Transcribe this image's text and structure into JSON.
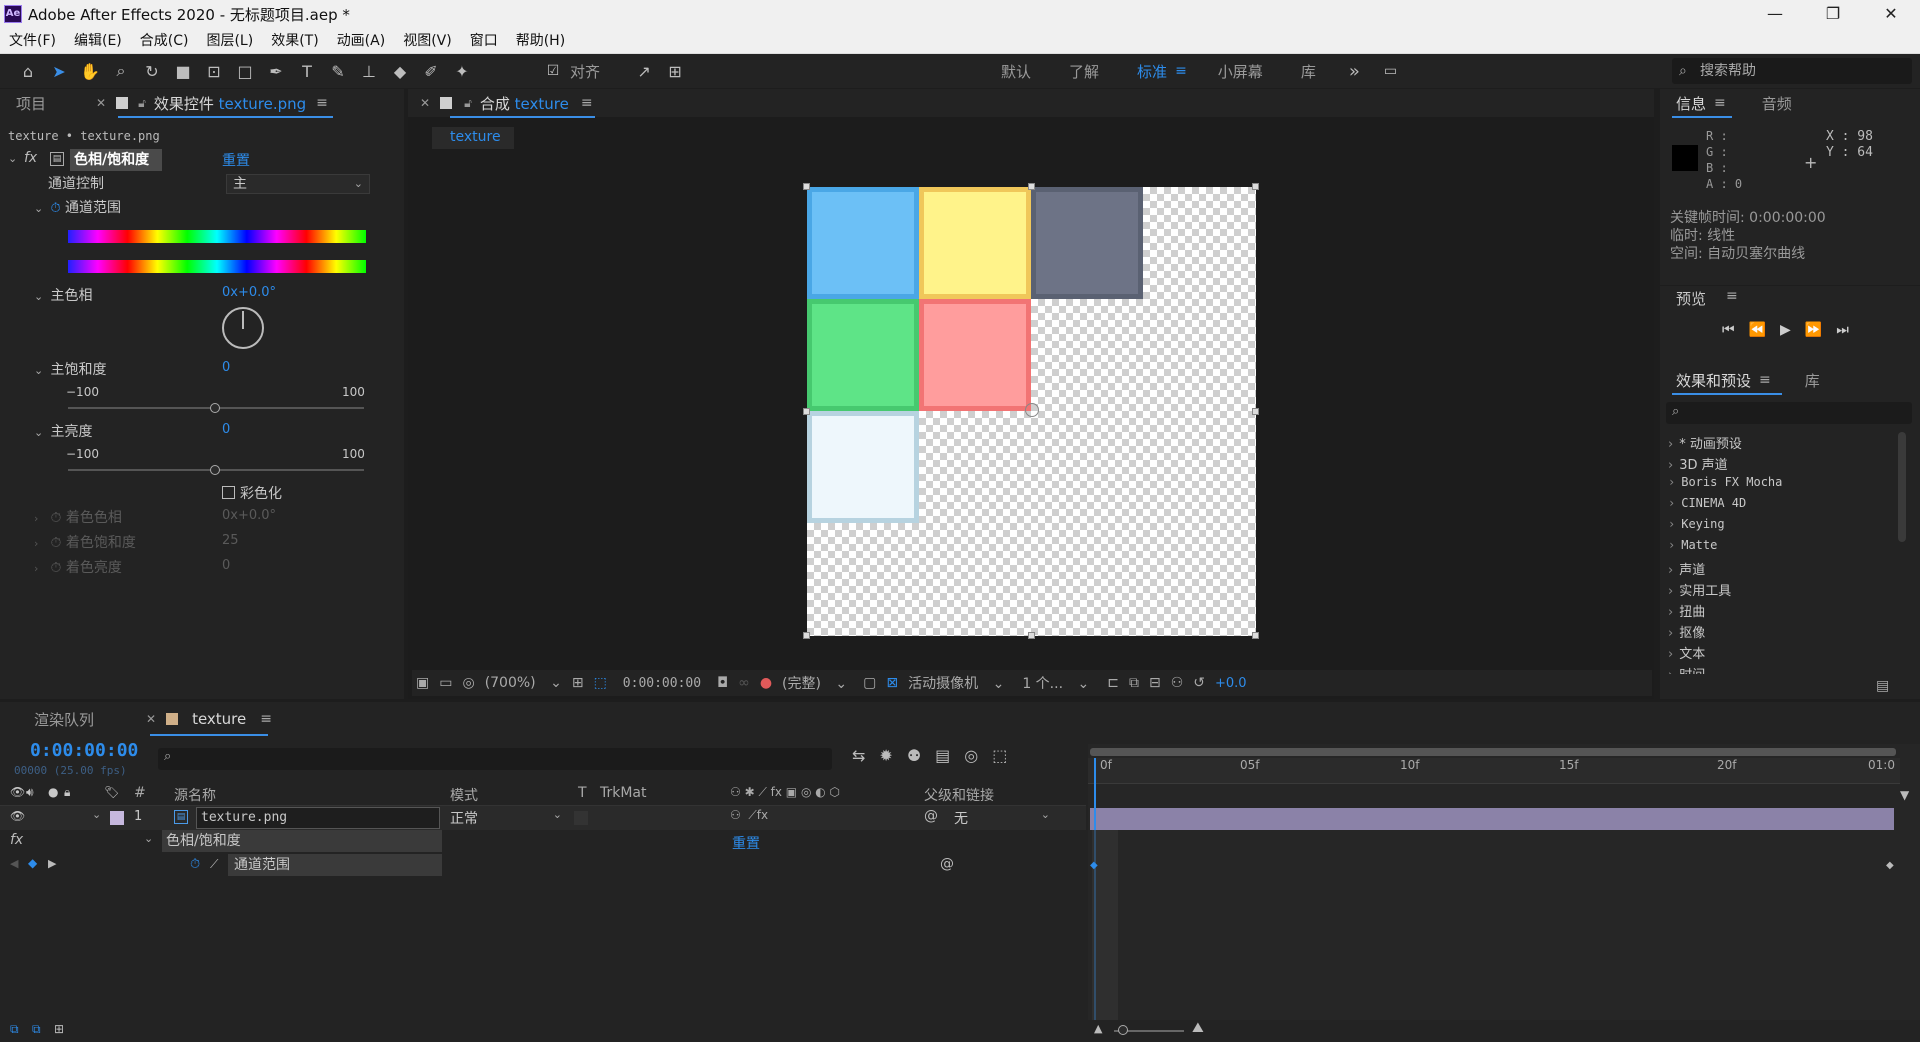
{
  "app": {
    "title": "Adobe After Effects 2020 - 无标题项目.aep *",
    "icon": "Ae",
    "window_controls": {
      "minimize": "—",
      "maximize": "❐",
      "close": "✕"
    }
  },
  "menu": [
    "文件(F)",
    "编辑(E)",
    "合成(C)",
    "图层(L)",
    "效果(T)",
    "动画(A)",
    "视图(V)",
    "窗口",
    "帮助(H)"
  ],
  "toolbar": {
    "tools": [
      "home-icon",
      "selection-icon",
      "hand-icon",
      "zoom-icon",
      "rotate-icon",
      "camera-icon",
      "pan-behind-icon",
      "rectangle-icon",
      "pen-icon",
      "text-icon",
      "brush-icon",
      "clone-stamp-icon",
      "eraser-icon",
      "roto-brush-icon",
      "puppet-pin-icon"
    ],
    "snap_label": "对齐",
    "workspaces": [
      "默认",
      "了解",
      "标准",
      "小屏幕",
      "库"
    ],
    "active_workspace": "标准",
    "more": "»",
    "search_placeholder": "搜索帮助"
  },
  "left_panel": {
    "tab_project": "项目",
    "tab_effects_prefix": "效果控件",
    "tab_effects_file": "texture.png",
    "breadcrumb": "texture • texture.png",
    "effect": {
      "fx": "fx",
      "name": "色相/饱和度",
      "reset": "重置",
      "channel_control_label": "通道控制",
      "channel_control_value": "主",
      "channel_range_label": "通道范围",
      "master_hue_label": "主色相",
      "master_hue_value": "0x+0.0°",
      "master_saturation_label": "主饱和度",
      "master_saturation_value": "0",
      "saturation_min": "−100",
      "saturation_max": "100",
      "master_lightness_label": "主亮度",
      "master_lightness_value": "0",
      "lightness_min": "−100",
      "lightness_max": "100",
      "colorize_label": "彩色化",
      "colorize_hue_label": "着色色相",
      "colorize_hue_value": "0x+0.0°",
      "colorize_saturation_label": "着色饱和度",
      "colorize_saturation_value": "25",
      "colorize_lightness_label": "着色亮度",
      "colorize_lightness_value": "0"
    }
  },
  "composition": {
    "tab_prefix": "合成",
    "tab_name": "texture",
    "sub_tab": "texture",
    "tiles": [
      {
        "color": "#6cc0f6",
        "border": "#4aa7e6",
        "col": 0,
        "row": 0
      },
      {
        "color": "#fff38a",
        "border": "#f0c75a",
        "col": 1,
        "row": 0
      },
      {
        "color": "#6d7386",
        "border": "#5a6172",
        "col": 2,
        "row": 0
      },
      {
        "color": "#5ee487",
        "border": "#46c96f",
        "col": 0,
        "row": 1
      },
      {
        "color": "#ff9d9d",
        "border": "#f27474",
        "col": 1,
        "row": 1
      },
      {
        "color": "#eef7fc",
        "border": "#b7d3e0",
        "col": 0,
        "row": 2
      }
    ],
    "footer": {
      "zoom": "(700%)",
      "timecode": "0:00:00:00",
      "resolution": "(完整)",
      "camera": "活动摄像机",
      "views": "1 个...",
      "exposure": "+0.0"
    }
  },
  "info_panel": {
    "tab_info": "信息",
    "tab_audio": "音频",
    "r": "R :",
    "g": "G :",
    "b": "B :",
    "a": "A : 0",
    "x": "X : 98",
    "y": "Y : 64",
    "keyframe_time": "关键帧时间: 0:00:00:00",
    "temporal": "临时: 线性",
    "spatial": "空间: 自动贝塞尔曲线"
  },
  "preview_panel": {
    "title": "预览"
  },
  "effects_presets": {
    "tab": "效果和预设",
    "tab_library": "库",
    "items": [
      "* 动画预设",
      "3D 声道",
      "Boris FX Mocha",
      "CINEMA 4D",
      "Keying",
      "Matte",
      "声道",
      "实用工具",
      "扭曲",
      "抠像",
      "文本",
      "时间"
    ]
  },
  "timeline": {
    "tab_render": "渲染队列",
    "tab_comp": "texture",
    "timecode": "0:00:00:00",
    "frames": "00000 (25.00 fps)",
    "columns": {
      "hash": "#",
      "source_name": "源名称",
      "mode": "模式",
      "t": "T",
      "trkmat": "TrkMat",
      "parent": "父级和链接"
    },
    "layer": {
      "number": "1",
      "name": "texture.png",
      "mode": "正常",
      "parent": "无",
      "effect": "色相/饱和度",
      "reset": "重置",
      "property": "通道范围"
    },
    "ruler": [
      "0f",
      "05f",
      "10f",
      "15f",
      "20f",
      "01:0"
    ]
  }
}
